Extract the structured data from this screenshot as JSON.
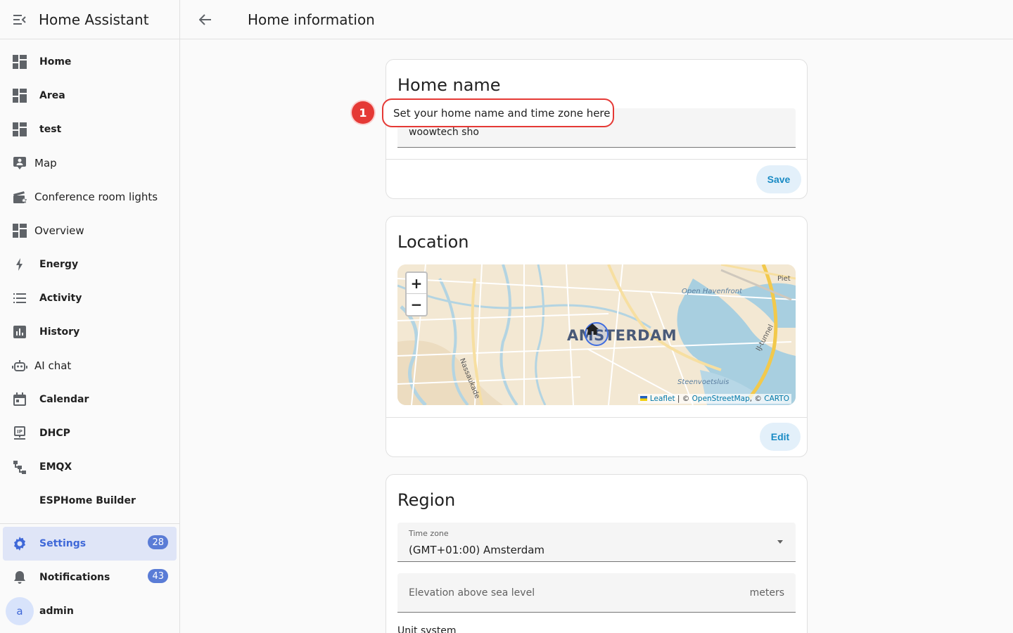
{
  "sidebar": {
    "title": "Home Assistant",
    "items": [
      {
        "label": "Home",
        "icon": "dashboard-icon"
      },
      {
        "label": "Area",
        "icon": "dashboard-icon"
      },
      {
        "label": "test",
        "icon": "dashboard-icon"
      },
      {
        "label": "Map",
        "icon": "map-person-icon"
      },
      {
        "label": "Conference room lights",
        "icon": "clapperboard-icon"
      },
      {
        "label": "Overview",
        "icon": "dashboard-icon"
      },
      {
        "label": "Energy",
        "icon": "lightning-icon"
      },
      {
        "label": "Activity",
        "icon": "list-icon"
      },
      {
        "label": "History",
        "icon": "chart-icon"
      },
      {
        "label": "AI chat",
        "icon": "robot-icon"
      },
      {
        "label": "Calendar",
        "icon": "calendar-icon"
      },
      {
        "label": "DHCP",
        "icon": "network-icon"
      },
      {
        "label": "EMQX",
        "icon": "sitemap-icon"
      },
      {
        "label": "ESPHome Builder",
        "icon": ""
      }
    ],
    "settings": {
      "label": "Settings",
      "badge": "28"
    },
    "notifications": {
      "label": "Notifications",
      "badge": "43"
    },
    "user": {
      "initial": "a",
      "label": "admin"
    }
  },
  "topbar": {
    "title": "Home information"
  },
  "home_name_card": {
    "title": "Home name",
    "value": "woowtech sho",
    "save_label": "Save"
  },
  "callout": {
    "step": "1",
    "text": "Set your home name and time zone here"
  },
  "location_card": {
    "title": "Location",
    "map": {
      "city_label": "AMSTERDAM",
      "labels": [
        "Open Havenfront",
        "Piet",
        "IJ-tunnel",
        "Nassaukade",
        "Steenvoetsluis"
      ],
      "zoom_in": "+",
      "zoom_out": "−",
      "attribution_leaflet": "Leaflet",
      "attribution_sep1": " | © ",
      "attribution_osm": "OpenStreetMap",
      "attribution_sep2": ", © ",
      "attribution_carto": "CARTO"
    },
    "edit_label": "Edit"
  },
  "region_card": {
    "title": "Region",
    "timezone_label": "Time zone",
    "timezone_value": "(GMT+01:00) Amsterdam",
    "elevation_placeholder": "Elevation above sea level",
    "elevation_suffix": "meters",
    "unit_system_label": "Unit system"
  },
  "colors": {
    "accent": "#3f68d8",
    "button_text": "#1a8bc4",
    "callout": "#e53935"
  }
}
